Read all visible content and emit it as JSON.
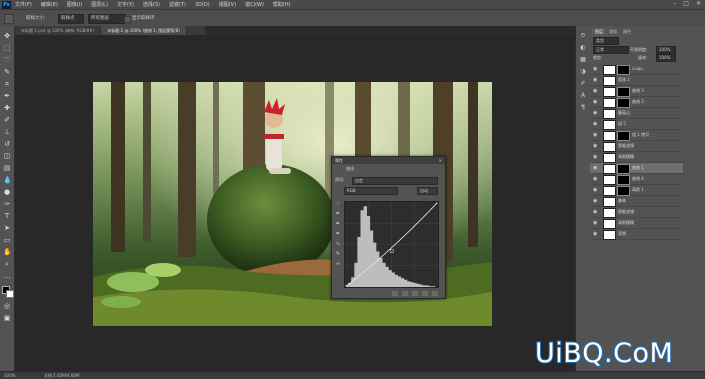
{
  "app": {
    "name": "Ps"
  },
  "menubar": {
    "items": [
      "文件(F)",
      "编辑(E)",
      "图像(I)",
      "图层(L)",
      "文字(Y)",
      "选择(S)",
      "滤镜(T)",
      "3D(D)",
      "视图(V)",
      "窗口(W)",
      "帮助(H)"
    ],
    "window_controls": {
      "minimize": "–",
      "maximize": "□",
      "close": "✕"
    }
  },
  "options_bar": {
    "tool_preset": "",
    "sample_label": "取样大小:",
    "sample_value": "取样点",
    "sample_dropdown": "所有图层",
    "show_ring": "显示取样环"
  },
  "tabs": [
    {
      "label": "未标题-1.psd @ 100% (森林, RGB/8#)",
      "active": false
    },
    {
      "label": "未标题-2 @ 100% (曲线 1, 图层蒙版/8)",
      "active": true
    },
    {
      "label": "",
      "active": false
    }
  ],
  "curves_panel": {
    "title": "属性",
    "subtitle": "曲线",
    "preset_label": "预设:",
    "preset_value": "自定",
    "channel_value": "RGB",
    "auto_label": "自动",
    "close": "✕",
    "collapse": "≡"
  },
  "chart_data": {
    "type": "area",
    "title": "",
    "xlim": [
      0,
      255
    ],
    "ylim": [
      0,
      255
    ],
    "histogram": [
      2,
      5,
      12,
      30,
      62,
      95,
      100,
      88,
      70,
      55,
      44,
      36,
      30,
      25,
      21,
      18,
      15,
      13,
      11,
      9,
      7,
      6,
      5,
      4,
      3,
      2,
      2,
      1,
      1,
      0
    ],
    "curve_points": [
      [
        0,
        0
      ],
      [
        128,
        108
      ],
      [
        255,
        255
      ]
    ],
    "grid": true
  },
  "layers_panel": {
    "tabs": [
      "图层",
      "通道",
      "路径"
    ],
    "kind_label": "类型",
    "blend_mode": "正常",
    "opacity_label": "不透明度:",
    "opacity_value": "100%",
    "lock_label": "锁定:",
    "fill_label": "填充:",
    "fill_value": "100%",
    "layers": [
      {
        "name": "cuiqu",
        "selected": false,
        "mask": true
      },
      {
        "name": "男孩 2",
        "selected": false,
        "mask": false
      },
      {
        "name": "曲线 3",
        "selected": false,
        "mask": true
      },
      {
        "name": "曲线 2",
        "selected": false,
        "mask": true
      },
      {
        "name": "蘑菇山",
        "selected": false,
        "mask": false
      },
      {
        "name": "组 5",
        "selected": false,
        "mask": false
      },
      {
        "name": "组 1 拷贝",
        "selected": false,
        "mask": true
      },
      {
        "name": "智能滤镜",
        "selected": false,
        "mask": false
      },
      {
        "name": "高斯模糊",
        "selected": false,
        "mask": false
      },
      {
        "name": "曲线 1",
        "selected": true,
        "mask": true
      },
      {
        "name": "曲线 4",
        "selected": false,
        "mask": true
      },
      {
        "name": "高斯 1",
        "selected": false,
        "mask": true
      },
      {
        "name": "森林",
        "selected": false,
        "mask": false
      },
      {
        "name": "智能滤镜",
        "selected": false,
        "mask": false
      },
      {
        "name": "高斯模糊",
        "selected": false,
        "mask": false
      },
      {
        "name": "背景",
        "selected": false,
        "mask": false
      }
    ]
  },
  "status": {
    "zoom": "100%",
    "doc": "文档:1.65M/4.60M"
  },
  "watermark": "UiBQ.CoM"
}
